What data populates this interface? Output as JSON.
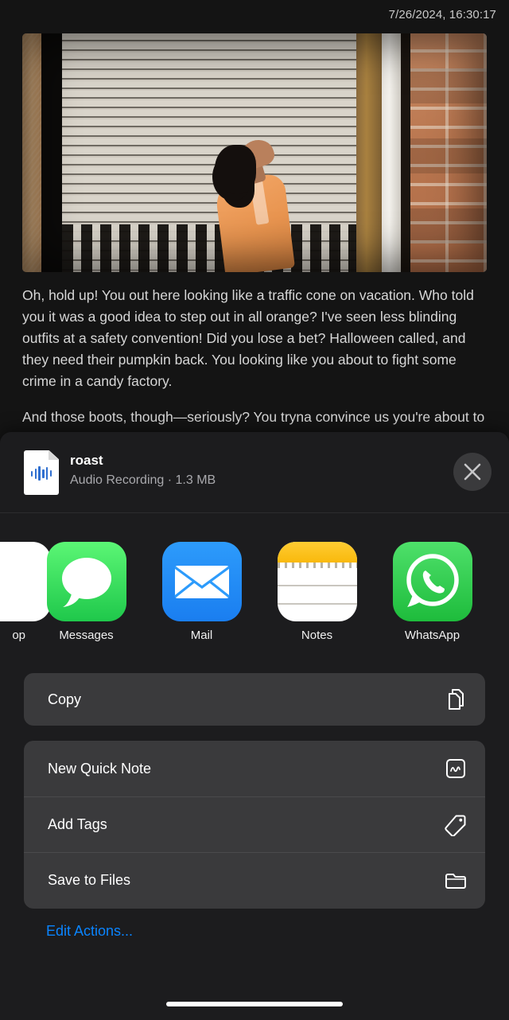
{
  "status": {
    "timestamp": "7/26/2024, 16:30:17"
  },
  "content": {
    "photo_alt": "person-in-orange-looking-up-at-roller-shutter",
    "paragraphs": [
      "Oh, hold up! You out here looking like a traffic cone on vacation. Who told you it was a good idea to step out in all orange? I've seen less blinding outfits at a safety convention! Did you lose a bet? Halloween called, and they need their pumpkin back. You looking like you about to fight some crime in a candy factory.",
      "And those boots, though—seriously? You tryna convince us you're about to go hiking on Mars or something? Timberlands"
    ]
  },
  "share_sheet": {
    "file": {
      "name": "roast",
      "subtitle": "Audio Recording · 1.3 MB",
      "icon": "audio-document-icon"
    },
    "close_label": "×",
    "apps": [
      {
        "label": "AirDrop",
        "visible_label": "op",
        "icon": "airdrop-icon",
        "partial": true
      },
      {
        "label": "Messages",
        "visible_label": "Messages",
        "icon": "messages-icon",
        "partial": false
      },
      {
        "label": "Mail",
        "visible_label": "Mail",
        "icon": "mail-icon",
        "partial": false
      },
      {
        "label": "Notes",
        "visible_label": "Notes",
        "icon": "notes-icon",
        "partial": false
      },
      {
        "label": "WhatsApp",
        "visible_label": "WhatsApp",
        "icon": "whatsapp-icon",
        "partial": false
      }
    ],
    "primary_actions": [
      {
        "label": "Copy",
        "icon": "copy-documents-icon"
      }
    ],
    "secondary_actions": [
      {
        "label": "New Quick Note",
        "icon": "quick-note-icon"
      },
      {
        "label": "Add Tags",
        "icon": "tag-icon"
      },
      {
        "label": "Save to Files",
        "icon": "folder-icon"
      }
    ],
    "edit_actions_label": "Edit Actions...",
    "accent_color": "#0a84ff",
    "sheet_background": "#1c1c1e",
    "card_background": "#3a3a3c"
  }
}
